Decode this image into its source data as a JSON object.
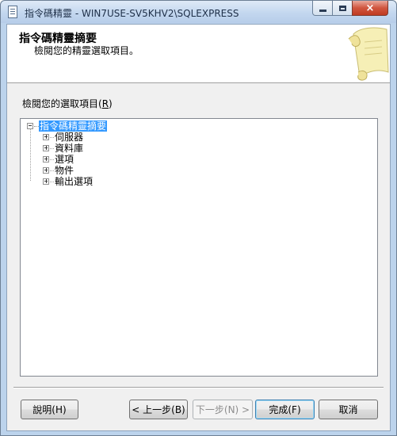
{
  "window": {
    "title": "指令碼精靈 - WIN7USE-SV5KHV2\\SQLEXPRESS",
    "minimize_glyph": "minimize-icon",
    "maximize_glyph": "maximize-icon",
    "close_glyph": "×"
  },
  "header": {
    "title": "指令碼精靈摘要",
    "subtitle": "檢閱您的精靈選取項目。",
    "art_icon": "scroll-icon"
  },
  "prompt": {
    "label": "檢閱您的選取項目",
    "mnemonic": "R"
  },
  "tree": {
    "root": "指令碼精靈摘要",
    "items": [
      "伺服器",
      "資料庫",
      "選項",
      "物件",
      "輸出選項"
    ]
  },
  "buttons": {
    "help": "說明(H)",
    "back": "< 上一步(B)",
    "next": "下一步(N) >",
    "finish": "完成(F)",
    "cancel": "取消"
  }
}
